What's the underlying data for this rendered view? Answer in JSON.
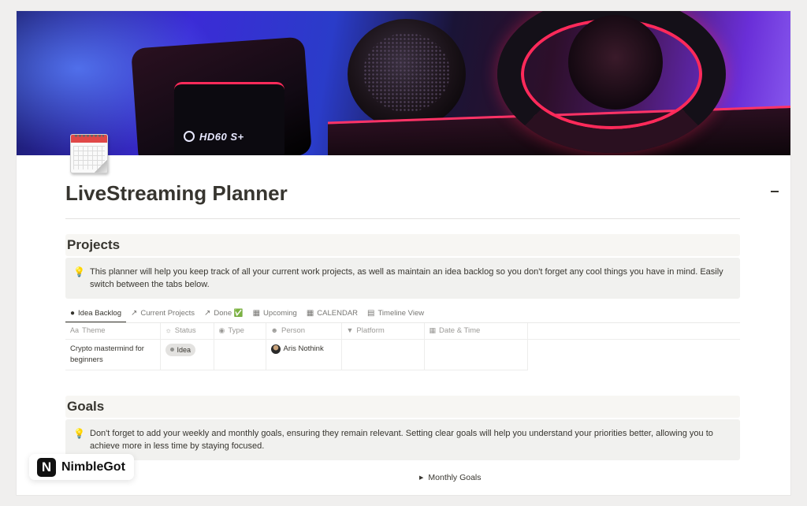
{
  "page": {
    "title": "LiveStreaming Planner",
    "cover_brand": "HD60 S+"
  },
  "projects": {
    "heading": "Projects",
    "callout": "This planner will help you keep track of all your current work projects, as well as maintain an idea backlog so you don't forget any cool things you have in mind. Easily switch between the tabs below.",
    "tabs": [
      {
        "label": "Idea Backlog",
        "icon": "bulb-icon",
        "active": true
      },
      {
        "label": "Current Projects",
        "icon": "arrow-up-right-icon"
      },
      {
        "label": "Done ✅",
        "icon": "arrow-up-right-icon"
      },
      {
        "label": "Upcoming",
        "icon": "calendar-icon"
      },
      {
        "label": "CALENDAR",
        "icon": "calendar-icon"
      },
      {
        "label": "Timeline View",
        "icon": "timeline-icon"
      }
    ],
    "columns": [
      {
        "label": "Theme",
        "icon": "text-icon"
      },
      {
        "label": "Status",
        "icon": "status-icon"
      },
      {
        "label": "Type",
        "icon": "multi-select-icon"
      },
      {
        "label": "Person",
        "icon": "people-icon"
      },
      {
        "label": "Platform",
        "icon": "select-icon"
      },
      {
        "label": "Date & Time",
        "icon": "calendar-icon"
      }
    ],
    "rows": [
      {
        "theme": "Crypto mastermind for beginners",
        "status": "Idea",
        "type": "",
        "person": "Aris Nothink",
        "platform": "",
        "date": ""
      }
    ]
  },
  "goals": {
    "heading": "Goals",
    "callout": "Don't forget to add your weekly and monthly goals, ensuring they remain relevant. Setting clear goals will help you understand your priorities better, allowing you to achieve more in less time by staying focused.",
    "toggle_monthly": "Monthly Goals"
  },
  "watermark": {
    "logo_letter": "N",
    "name": "NimbleGot"
  },
  "colors": {
    "page_bg": "#ffffff",
    "outer_bg": "#f0efee",
    "text": "#37352f",
    "muted": "#787774",
    "callout_bg": "#f1f1ef"
  }
}
